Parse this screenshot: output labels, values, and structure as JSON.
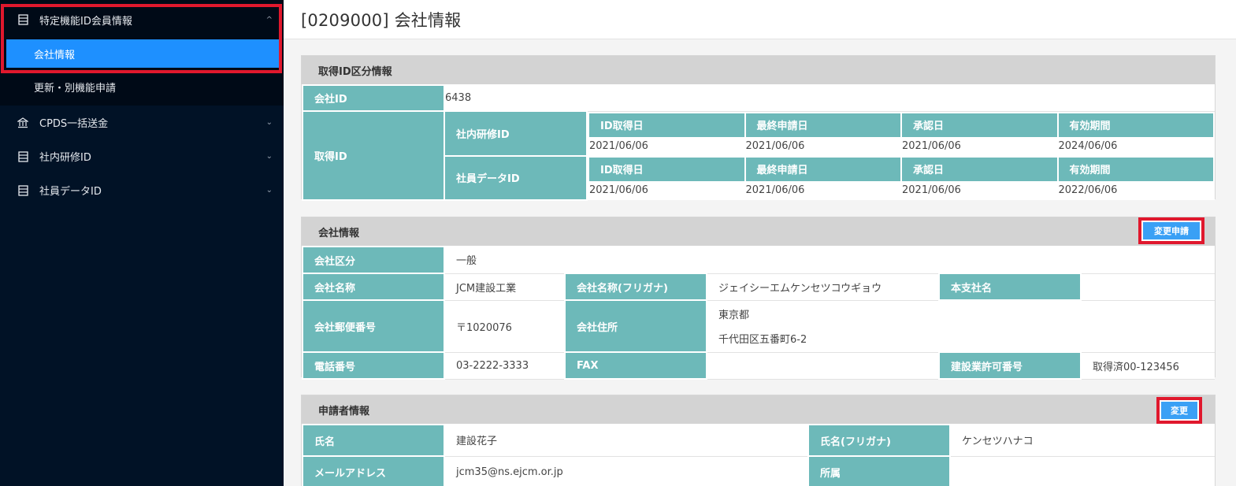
{
  "sidebar": {
    "group1": {
      "label": "特定機能ID会員情報",
      "chevron": "^",
      "icon": "list-icon"
    },
    "sub_active": "会社情報",
    "sub_plain": "更新・別機能申請",
    "items": [
      {
        "label": "CPDS一括送金",
        "icon": "bank-icon"
      },
      {
        "label": "社内研修ID",
        "icon": "list-icon"
      },
      {
        "label": "社員データID",
        "icon": "list-icon"
      }
    ]
  },
  "page": {
    "title": "[0209000] 会社情報"
  },
  "id_panel": {
    "title": "取得ID区分情報",
    "company_id_label": "会社ID",
    "company_id": "6438",
    "acq_label": "取得ID",
    "headers": [
      "ID取得日",
      "最終申請日",
      "承認日",
      "有効期間"
    ],
    "rows": [
      {
        "name": "社内研修ID",
        "values": [
          "2021/06/06",
          "2021/06/06",
          "2021/06/06",
          "2024/06/06"
        ]
      },
      {
        "name": "社員データID",
        "values": [
          "2021/06/06",
          "2021/06/06",
          "2021/06/06",
          "2022/06/06"
        ]
      }
    ]
  },
  "company_panel": {
    "title": "会社情報",
    "button": "変更申請",
    "kubun_label": "会社区分",
    "kubun": "一般",
    "name_label": "会社名称",
    "name": "JCM建設工業",
    "kana_label": "会社名称(フリガナ)",
    "kana": "ジェイシーエムケンセツコウギョウ",
    "branch_label": "本支社名",
    "branch": "",
    "zip_label": "会社郵便番号",
    "zip": "〒1020076",
    "addr_label": "会社住所",
    "addr1": "東京都",
    "addr2": "千代田区五番町6-2",
    "tel_label": "電話番号",
    "tel": "03-2222-3333",
    "fax_label": "FAX",
    "fax": "",
    "license_label": "建設業許可番号",
    "license": "取得済00-123456"
  },
  "applicant_panel": {
    "title": "申請者情報",
    "button": "変更",
    "name_label": "氏名",
    "name": "建設花子",
    "kana_label": "氏名(フリガナ)",
    "kana": "ケンセツハナコ",
    "mail_label": "メールアドレス",
    "mail": "jcm35@ns.ejcm.or.jp",
    "dept_label": "所属",
    "dept": ""
  }
}
